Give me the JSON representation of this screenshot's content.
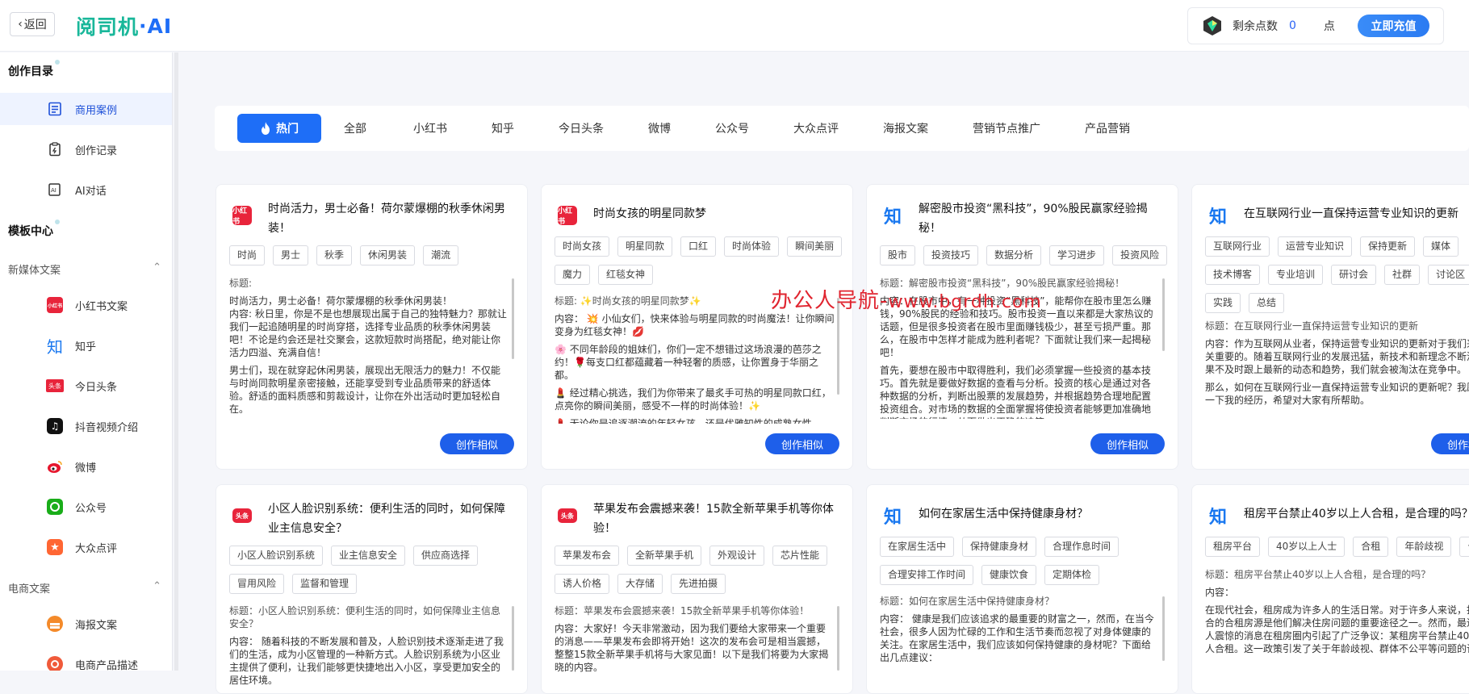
{
  "header": {
    "back_label": "返回",
    "logo_text": "阅司机",
    "logo_ai": "·AI",
    "points_label": "剩余点数",
    "points_value": "0",
    "points_unit": "点",
    "recharge_label": "立即充值"
  },
  "sidebar": {
    "section1": "创作目录",
    "items1": [
      {
        "label": "商用案例",
        "icon": "document-list-icon",
        "active": true
      },
      {
        "label": "创作记录",
        "icon": "clipboard-icon"
      },
      {
        "label": "AI对话",
        "icon": "ai-chat-icon"
      }
    ],
    "section2": "模板中心",
    "group1": "新媒体文案",
    "items2": [
      {
        "label": "小红书文案",
        "icon": "xiaohongshu-icon"
      },
      {
        "label": "知乎",
        "icon": "zhihu-icon"
      },
      {
        "label": "今日头条",
        "icon": "toutiao-icon"
      },
      {
        "label": "抖音视频介绍",
        "icon": "douyin-icon"
      },
      {
        "label": "微博",
        "icon": "weibo-icon"
      },
      {
        "label": "公众号",
        "icon": "wechat-icon"
      },
      {
        "label": "大众点评",
        "icon": "dianping-icon"
      }
    ],
    "group2": "电商文案",
    "items3": [
      {
        "label": "海报文案",
        "icon": "poster-icon"
      },
      {
        "label": "电商产品描述",
        "icon": "product-icon"
      }
    ]
  },
  "tabs": [
    "热门",
    "全部",
    "小红书",
    "知乎",
    "今日头条",
    "微博",
    "公众号",
    "大众点评",
    "海报文案",
    "营销节点推广",
    "产品营销"
  ],
  "watermark": {
    "cn": "办公人导航-",
    "url": "www.bgrdh.com"
  },
  "create_similar_label": "创作相似",
  "cards": [
    {
      "platform": "小红书",
      "title": "时尚活力，男士必备！荷尔蒙爆棚的秋季休闲男装！",
      "tags": [
        "时尚",
        "男士",
        "秋季",
        "休闲男装",
        "潮流"
      ],
      "body_title": "标题:",
      "paragraphs": [
        "时尚活力，男士必备！荷尔蒙爆棚的秋季休闲男装！\n内容: 秋日里，你是不是也想展现出属于自己的独特魅力？那就让我们一起追随明星的时尚穿搭，选择专业品质的秋季休闲男装吧！不论是约会还是社交聚会，这款短款时尚搭配，绝对能让你活力四溢、充满自信！",
        "男士们，现在就穿起休闲男装，展现出无限活力的魅力！不仅能与时尚同款明星亲密接触，还能享受到专业品质带来的舒适体验。舒适的面料质感和剪裁设计，让你在外出活动时更加轻松自在。"
      ]
    },
    {
      "platform": "小红书",
      "title": "时尚女孩的明星同款梦",
      "tags": [
        "时尚女孩",
        "明星同款",
        "口红",
        "时尚体验",
        "瞬间美丽",
        "魔力",
        "红毯女神"
      ],
      "body_title": "标题: ✨时尚女孩的明星同款梦✨",
      "paragraphs": [
        "内容： 💥 小仙女们，快来体验与明星同款的时尚魔法！让你瞬间变身为红毯女神！💋",
        "🌸 不同年龄段的姐妹们，你们一定不想错过这场浪漫的芭莎之约！🌹每支口红都蕴藏着一种轻奢的质感，让你置身于华丽之都。",
        "💄 经过精心挑选，我们为你带来了最炙手可热的明星同款口红，点亮你的瞬间美丽，感受不一样的时尚体验！✨",
        "💄 无论你是追逐潮流的年轻女孩，还是优雅知性的成熟女性"
      ]
    },
    {
      "platform": "知乎",
      "title": "解密股市投资“黑科技”，90%股民赢家经验揭秘！",
      "tags": [
        "股市",
        "投资技巧",
        "数据分析",
        "学习进步",
        "投资风险"
      ],
      "body_title": "标题：解密股市投资“黑科技”，90%股民赢家经验揭秘！",
      "paragraphs": [
        "内容：在股市中，有一种投资“黑科技”，能帮你在股市里怎么赚钱，90%股民的经验和技巧。股市投资一直以来都是大家热议的话题，但是很多投资者在股市里面赚钱极少，甚至亏损严重。那么，在股市中怎样才能成为胜利者呢？下面就让我们来一起揭秘吧！",
        "首先，要想在股市中取得胜利，我们必须掌握一些投资的基本技巧。首先就是要做好数据的查看与分析。投资的核心是通过对各种数据的分析，判断出股票的发展趋势，并根据趋势合理地配置投资组合。对市场的数据的全面掌握将使投资者能够更加准确地判断市场的行情，从而做出正确的决策。"
      ]
    },
    {
      "platform": "知乎",
      "title": "在互联网行业一直保持运营专业知识的更新",
      "tags": [
        "互联网行业",
        "运营专业知识",
        "保持更新",
        "媒体",
        "技术博客",
        "专业培训",
        "研讨会",
        "社群",
        "讨论区",
        "实践",
        "总结"
      ],
      "body_title": "标题：在互联网行业一直保持运营专业知识的更新",
      "paragraphs": [
        "内容：作为互联网从业者，保持运营专业知识的更新对于我们来说是至关重要的。随着互联网行业的发展迅猛，新技术和新理念不断涌现，如果不及时跟上最新的动态和趋势，我们就会被淘汰在竞争中。",
        "那么，如何在互联网行业一直保持运营专业知识的更新呢？我愿意分享一下我的经历，希望对大家有所帮助。"
      ]
    },
    {
      "platform": "今日头条",
      "title": "小区人脸识别系统：便利生活的同时，如何保障业主信息安全？",
      "tags": [
        "小区人脸识别系统",
        "业主信息安全",
        "供应商选择",
        "冒用风险",
        "监督和管理"
      ],
      "body_title": "标题：小区人脸识别系统：便利生活的同时，如何保障业主信息安全？",
      "paragraphs": [
        "内容： 随着科技的不断发展和普及，人脸识别技术逐渐走进了我们的生活，成为小区管理的一种新方式。人脸识别系统为小区业主提供了便利，让我们能够更快捷地出入小区，享受更加安全的居住环境。"
      ]
    },
    {
      "platform": "今日头条",
      "title": "苹果发布会震撼来袭！15款全新苹果手机等你体验！",
      "tags": [
        "苹果发布会",
        "全新苹果手机",
        "外观设计",
        "芯片性能",
        "诱人价格",
        "大存储",
        "先进拍摄"
      ],
      "body_title": "标题：苹果发布会震撼来袭！15款全新苹果手机等你体验！",
      "paragraphs": [
        "内容：大家好！今天非常激动，因为我们要给大家带来一个重要的消息——苹果发布会即将开始！这次的发布会可是相当震撼，整整15款全新苹果手机将与大家见面！以下是我们将要为大家揭晓的内容。"
      ]
    },
    {
      "platform": "知乎",
      "title": "如何在家居生活中保持健康身材？",
      "tags": [
        "在家居生活中",
        "保持健康身材",
        "合理作息时间",
        "合理安排工作时间",
        "健康饮食",
        "定期体检"
      ],
      "body_title": "标题：如何在家居生活中保持健康身材？",
      "paragraphs": [
        "内容： 健康是我们应该追求的最重要的财富之一，然而，在当今社会，很多人因为忙碌的工作和生活节奏而忽视了对身体健康的关注。在家居生活中，我们应该如何保持健康的身材呢？下面给出几点建议："
      ]
    },
    {
      "platform": "知乎",
      "title": "租房平台禁止40岁以上人合租，是合理的吗？",
      "tags": [
        "租房平台",
        "40岁以上人士",
        "合租",
        "年龄歧视",
        "公平"
      ],
      "body_title": "标题：租房平台禁止40岁以上人合租，是合理的吗？",
      "paragraphs": [
        "内容：",
        "在现代社会，租房成为许多人的生活日常。对于许多人来说，找一个适合的合租房源是他们解决住房问题的重要途径之一。然而，最近一个让人震惊的消息在租房圈内引起了广泛争议：某租房平台禁止40岁以上人合租。这一政策引发了关于年龄歧视、群体不公平等问题的讨论。"
      ]
    }
  ]
}
